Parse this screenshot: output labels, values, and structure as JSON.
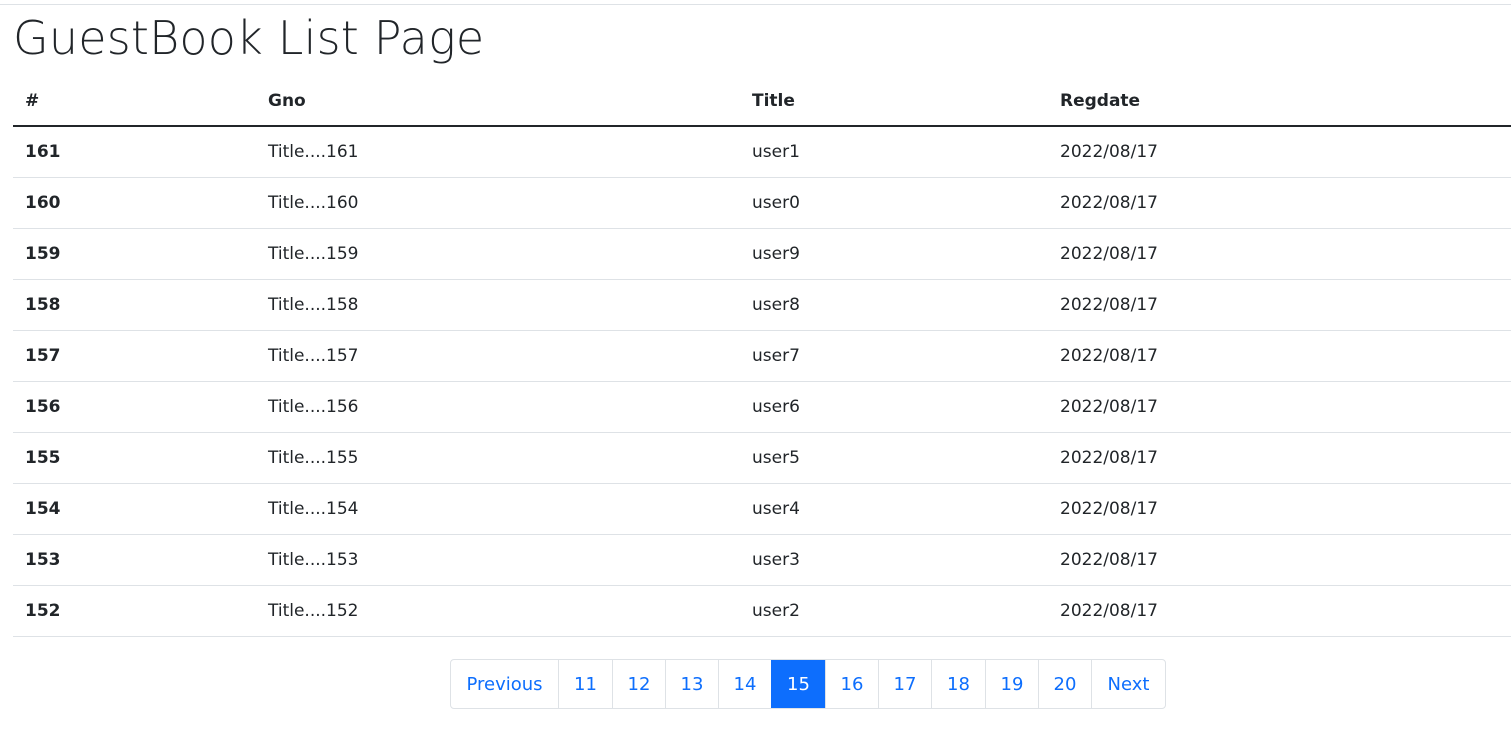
{
  "page": {
    "title": "GuestBook List Page"
  },
  "table": {
    "headers": [
      "#",
      "Gno",
      "Title",
      "Regdate"
    ],
    "rows": [
      [
        "161",
        "Title....161",
        "user1",
        "2022/08/17"
      ],
      [
        "160",
        "Title....160",
        "user0",
        "2022/08/17"
      ],
      [
        "159",
        "Title....159",
        "user9",
        "2022/08/17"
      ],
      [
        "158",
        "Title....158",
        "user8",
        "2022/08/17"
      ],
      [
        "157",
        "Title....157",
        "user7",
        "2022/08/17"
      ],
      [
        "156",
        "Title....156",
        "user6",
        "2022/08/17"
      ],
      [
        "155",
        "Title....155",
        "user5",
        "2022/08/17"
      ],
      [
        "154",
        "Title....154",
        "user4",
        "2022/08/17"
      ],
      [
        "153",
        "Title....153",
        "user3",
        "2022/08/17"
      ],
      [
        "152",
        "Title....152",
        "user2",
        "2022/08/17"
      ]
    ]
  },
  "pagination": {
    "previous_label": "Previous",
    "next_label": "Next",
    "pages": [
      "11",
      "12",
      "13",
      "14",
      "15",
      "16",
      "17",
      "18",
      "19",
      "20"
    ],
    "active": "15"
  },
  "colors": {
    "link": "#0d6efd",
    "active_bg": "#0d6efd",
    "border": "#dee2e6",
    "text": "#212529"
  }
}
